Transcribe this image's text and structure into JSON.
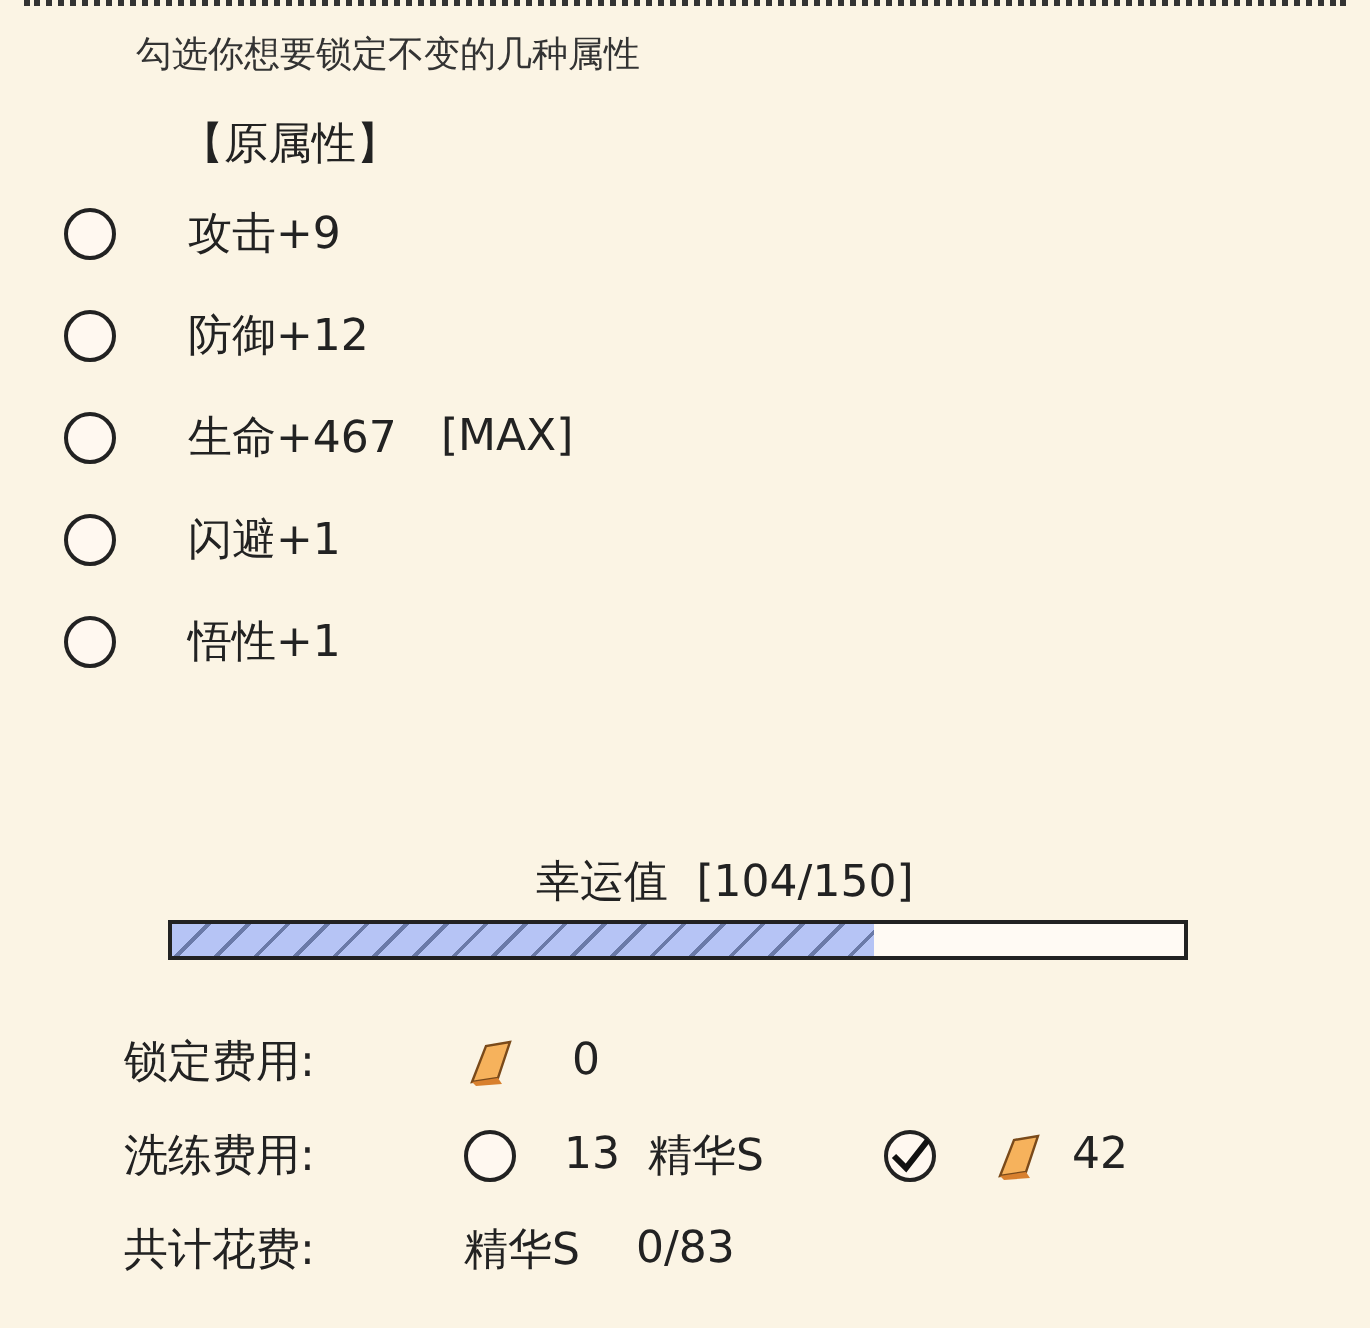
{
  "hint": "勾选你想要锁定不变的几种属性",
  "section_title": "【原属性】",
  "attributes": [
    {
      "label": "攻击+9",
      "checked": false
    },
    {
      "label": "防御+12",
      "checked": false
    },
    {
      "label": "生命+467",
      "tag": "[MAX]",
      "checked": false
    },
    {
      "label": "闪避+1",
      "checked": false
    },
    {
      "label": "悟性+1",
      "checked": false
    }
  ],
  "luck": {
    "label": "幸运值",
    "reading": "[104/150]",
    "level": 0.693
  },
  "lock_cost": {
    "label": "锁定费用:",
    "amount": "0"
  },
  "refine_cost": {
    "label": "洗练费用:",
    "options": [
      {
        "kind": "essence",
        "selected": false,
        "amount": "13",
        "unit": "精华S"
      },
      {
        "kind": "gold",
        "selected": true,
        "amount": "42"
      }
    ]
  },
  "total_cost": {
    "label": "共计花费:",
    "unit": "精华S",
    "reading": "0/83"
  }
}
